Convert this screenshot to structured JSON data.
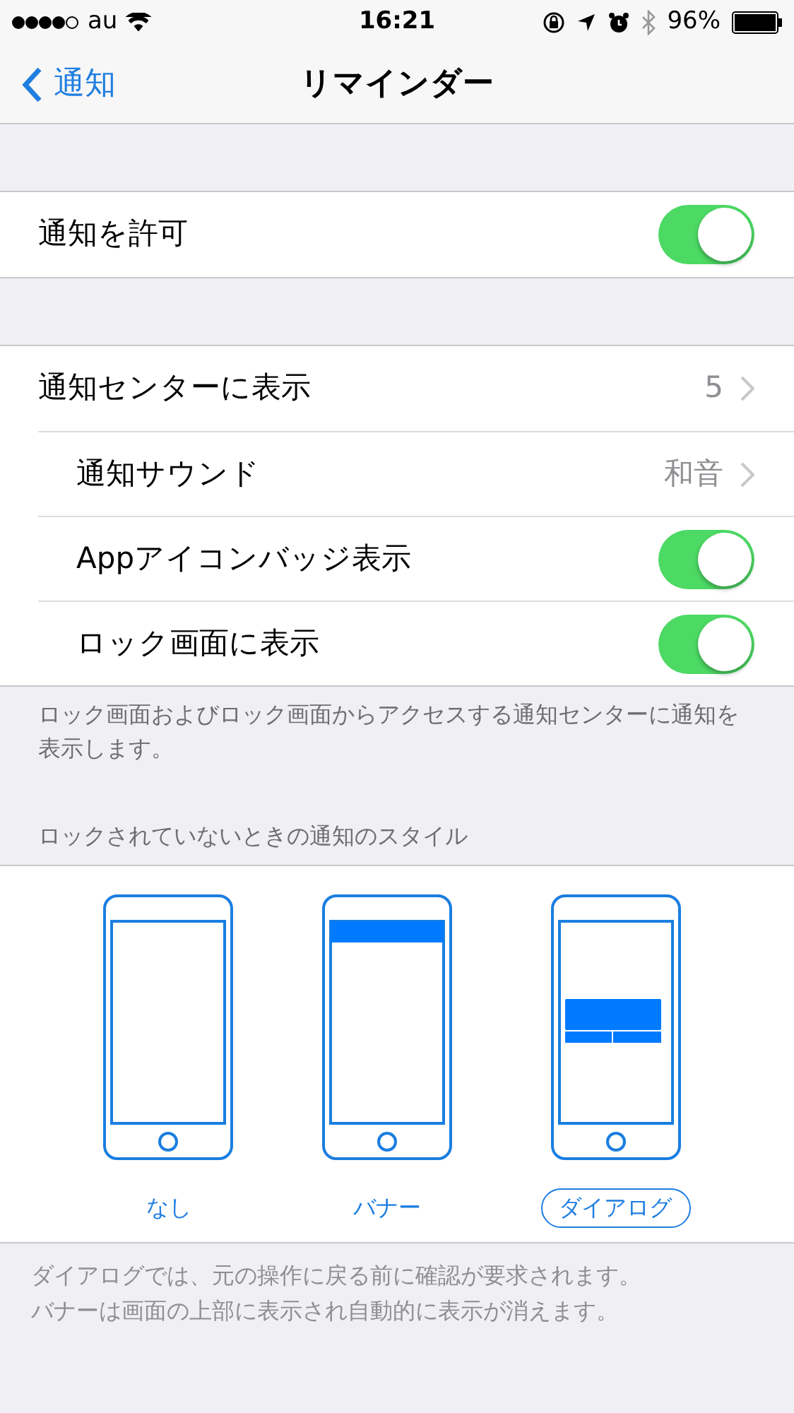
{
  "status_bar": {
    "carrier": "au",
    "time": "16:21",
    "battery": "96%"
  },
  "nav": {
    "back": "通知",
    "title": "リマインダー"
  },
  "groups": [
    {
      "rows": [
        {
          "kind": "toggle",
          "label": "通知を許可",
          "on": true
        }
      ]
    },
    {
      "rows": [
        {
          "kind": "value",
          "label": "通知センターに表示",
          "value": "5"
        },
        {
          "kind": "value",
          "label": "通知サウンド",
          "value": "和音"
        },
        {
          "kind": "toggle",
          "label": "Appアイコンバッジ表示",
          "on": true
        },
        {
          "kind": "toggle",
          "label": "ロック画面に表示",
          "on": true
        }
      ],
      "footer": "ロック画面およびロック画面からアクセスする通知センターに通知を表示します。"
    }
  ],
  "alert_style": {
    "header": "ロックされていないときの通知のスタイル",
    "options": [
      {
        "kind": "none",
        "label": "なし",
        "selected": false
      },
      {
        "kind": "banner",
        "label": "バナー",
        "selected": false
      },
      {
        "kind": "dialog",
        "label": "ダイアログ",
        "selected": true
      }
    ],
    "footer": [
      "ダイアログでは、元の操作に戻る前に確認が要求されます。",
      "バナーは画面の上部に表示され自動的に表示が消えます。"
    ]
  }
}
